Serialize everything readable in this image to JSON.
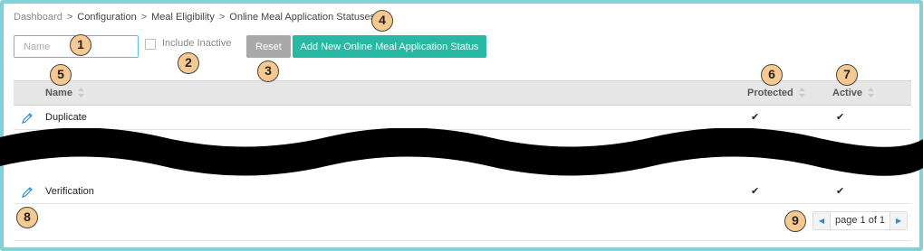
{
  "breadcrumb": {
    "items": [
      "Dashboard",
      "Configuration",
      "Meal Eligibility",
      "Online Meal Application Statuses"
    ],
    "separator": ">"
  },
  "filters": {
    "name_placeholder": "Name",
    "include_inactive_label": "Include Inactive",
    "include_inactive_checked": false
  },
  "buttons": {
    "reset_label": "Reset",
    "add_label": "Add New Online Meal Application Status"
  },
  "table": {
    "headers": {
      "name": "Name",
      "protected": "Protected",
      "active": "Active"
    },
    "rows": [
      {
        "name": "Duplicate",
        "protected": "✔",
        "active": "✔"
      },
      {
        "name": "Verification",
        "protected": "✔",
        "active": "✔"
      }
    ]
  },
  "pagination": {
    "label": "page 1 of 1"
  },
  "markers": [
    "1",
    "2",
    "3",
    "4",
    "5",
    "6",
    "7",
    "8",
    "9"
  ],
  "colors": {
    "accent": "#28b9a4",
    "reset": "#a9a9a9",
    "frame": "#7fd3d8",
    "marker": "#f8c98f",
    "link": "#2a8fd6"
  },
  "icons": {
    "edit": "pencil-icon",
    "sort": "sort-icon",
    "prev": "chevron-left-icon",
    "next": "chevron-right-icon"
  }
}
